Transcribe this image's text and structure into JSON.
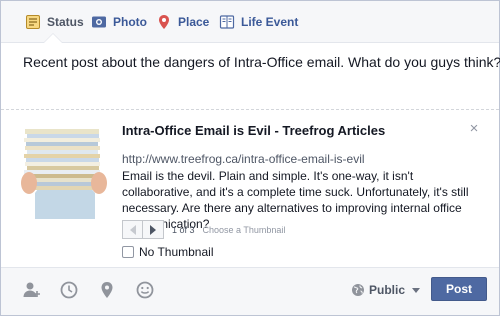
{
  "tabs": [
    {
      "label": "Status",
      "icon": "status-icon",
      "active": true
    },
    {
      "label": "Photo",
      "icon": "photo-icon"
    },
    {
      "label": "Place",
      "icon": "place-icon"
    },
    {
      "label": "Life Event",
      "icon": "life-event-icon"
    }
  ],
  "status_text": "Recent post about the dangers of Intra-Office email. What do you guys think?",
  "link_preview": {
    "title": "Intra-Office Email is Evil - Treefrog Articles",
    "url": "http://www.treefrog.ca/intra-office-email-is-evil",
    "description": "Email is the devil. Plain and simple. It's one-way, it isn't collaborative, and it's a complete time suck. Unfortunately, it's still necessary. Are there any alternatives to improving internal office communication?",
    "close": "×",
    "thumb_count": "1 of 3",
    "choose_thumbnail": "Choose a Thumbnail",
    "no_thumbnail_label": "No Thumbnail",
    "no_thumbnail_checked": false
  },
  "footer": {
    "icons": [
      "tag-people-icon",
      "clock-icon",
      "location-pin-icon",
      "smiley-icon"
    ],
    "audience": "Public",
    "post_label": "Post"
  },
  "colors": {
    "link_blue": "#3b5998",
    "post_button": "#4e69a2",
    "tab_bar_bg": "#f6f7f9",
    "border": "#bdc4d4"
  }
}
